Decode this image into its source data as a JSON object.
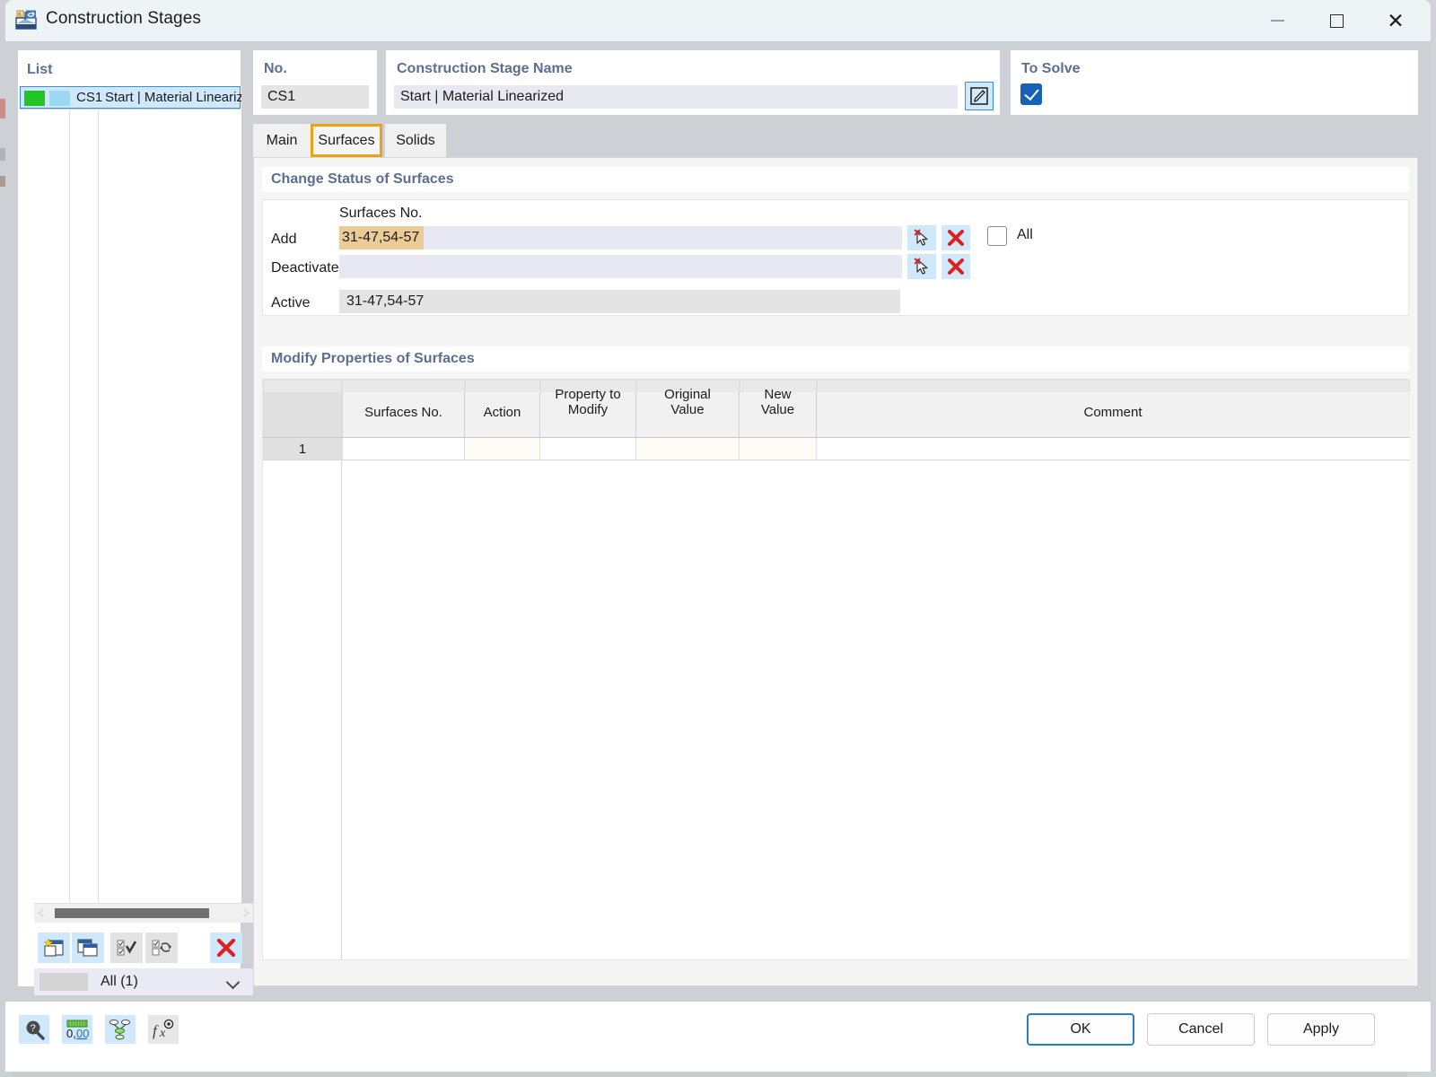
{
  "window": {
    "title": "Construction Stages",
    "icon": "construction-stages-icon",
    "minimize_label": "—",
    "maximize_label": "□",
    "close_label": "✕"
  },
  "list_panel": {
    "title": "List",
    "rows": [
      {
        "color_1": "#22c522",
        "color_2": "#9bd9f4",
        "no": "CS1",
        "name": "Start | Material Lineariz"
      }
    ],
    "toolbar": [
      {
        "name": "new-stage-button",
        "icon": "new-window-icon"
      },
      {
        "name": "copy-stage-button",
        "icon": "copy-window-icon"
      },
      {
        "name": "select-all-button",
        "icon": "check-all-icon"
      },
      {
        "name": "invert-selection-button",
        "icon": "invert-selection-icon"
      },
      {
        "name": "delete-stage-button",
        "icon": "red-x-icon"
      }
    ],
    "filter_value": "All (1)"
  },
  "no_panel": {
    "label": "No.",
    "value": "CS1"
  },
  "name_panel": {
    "label": "Construction Stage Name",
    "value": "Start | Material Linearized",
    "edit_icon": "edit-pencil-icon"
  },
  "solve_panel": {
    "label": "To Solve",
    "checked": true
  },
  "tabs": [
    {
      "label": "Main",
      "selected": false
    },
    {
      "label": "Surfaces",
      "selected": true
    },
    {
      "label": "Solids",
      "selected": false
    }
  ],
  "change_status": {
    "title": "Change Status of Surfaces",
    "column_header": "Surfaces No.",
    "rows": [
      {
        "label": "Add",
        "value": "31-47,54-57",
        "highlighted": true
      },
      {
        "label": "Deactivate",
        "value": "",
        "highlighted": false
      }
    ],
    "active_label": "Active",
    "active_value": "31-47,54-57",
    "all_label": "All",
    "all_checked": false,
    "pick_icon": "pick-cursor-icon",
    "clear_icon": "red-x-icon"
  },
  "modify_properties": {
    "title": "Modify Properties of Surfaces",
    "columns": [
      "Surfaces No.",
      "Action",
      "Property to\nModify",
      "Original\nValue",
      "New\nValue",
      "Comment"
    ],
    "column_labels": {
      "surfaces_no": "Surfaces No.",
      "action": "Action",
      "property_to_modify_line1": "Property to",
      "property_to_modify_line2": "Modify",
      "original_value_line1": "Original",
      "original_value_line2": "Value",
      "new_value_line1": "New",
      "new_value_line2": "Value",
      "comment": "Comment"
    },
    "rows": [
      {
        "no": "1",
        "surfaces_no": "",
        "action": "",
        "property": "",
        "original_value": "",
        "new_value": "",
        "comment": ""
      }
    ]
  },
  "footer": {
    "tools": [
      {
        "name": "help-lookup-button",
        "icon": "magnifier-question-icon"
      },
      {
        "name": "decimal-places-button",
        "icon": "number-format-icon"
      },
      {
        "name": "filter-button",
        "icon": "funnel-nodes-icon"
      },
      {
        "name": "formula-button",
        "icon": "fx-icon"
      }
    ],
    "ok_label": "OK",
    "cancel_label": "Cancel",
    "apply_label": "Apply"
  },
  "colors": {
    "accent_blue": "#1561b5",
    "section_heading": "#5c6f91",
    "tab_selected_border": "#e8a317",
    "highlight_field": "#eccc96",
    "input_bg": "#e7e8f2",
    "readonly_bg": "#e4e4e4",
    "row_selected": "#cfe8fb",
    "red_x": "#e02020",
    "green_swatch": "#22c522",
    "blue_swatch": "#9bd9f4"
  }
}
